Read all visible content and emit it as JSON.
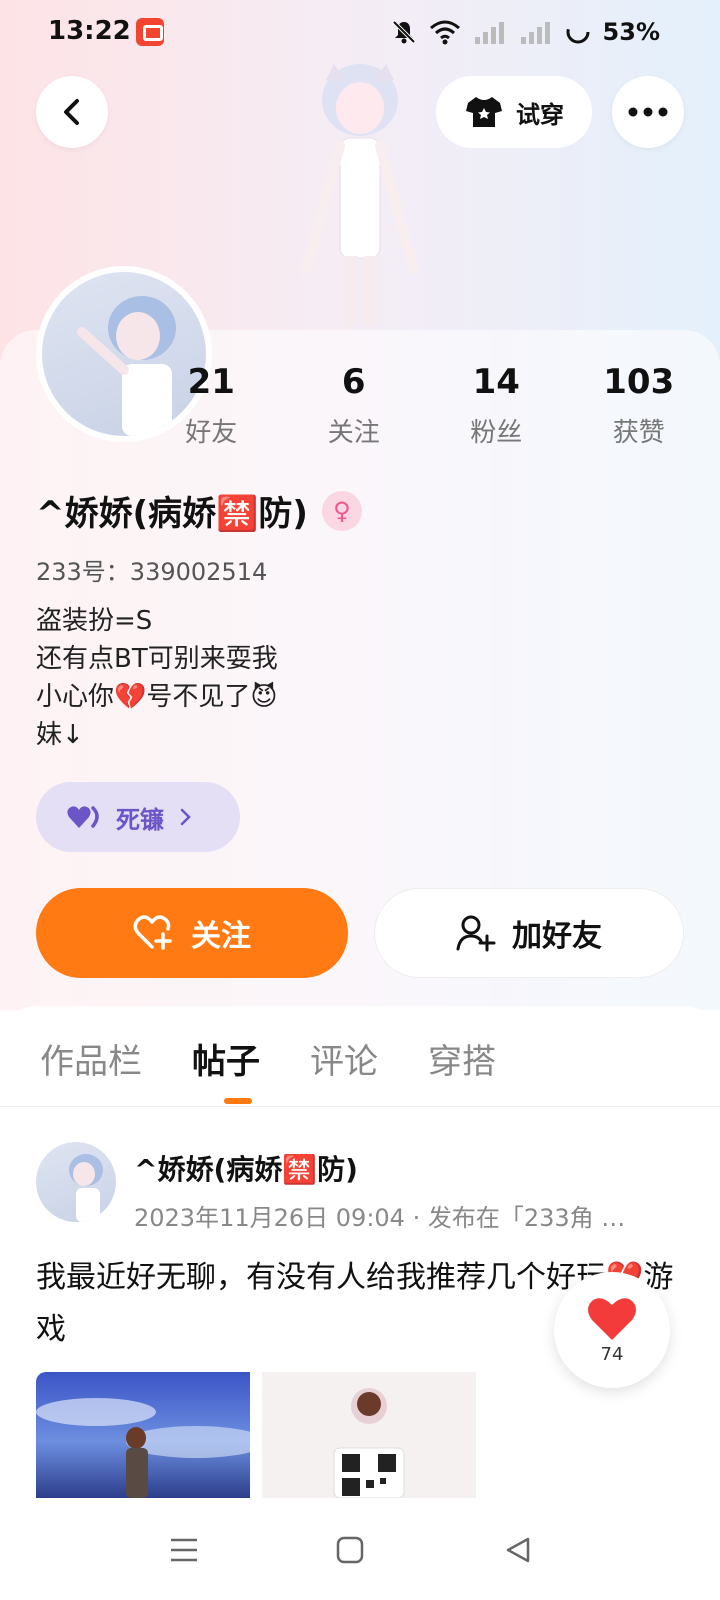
{
  "status_bar": {
    "time": "13:22",
    "battery": "53%",
    "icons": [
      "mute-icon",
      "wifi-icon",
      "signal-icon",
      "signal-icon",
      "battery-icon"
    ]
  },
  "header": {
    "try_on_label": "试穿",
    "icons": {
      "back": "chevron-left-icon",
      "try_on": "tshirt-icon",
      "more": "ellipsis-icon"
    }
  },
  "profile": {
    "stats": [
      {
        "value": "21",
        "label": "好友"
      },
      {
        "value": "6",
        "label": "关注"
      },
      {
        "value": "14",
        "label": "粉丝"
      },
      {
        "value": "103",
        "label": "获赞"
      }
    ],
    "name": "^娇娇(病娇🈲防)",
    "gender_symbol": "♀",
    "user_id": "233号：339002514",
    "bio": [
      "盗装扮=S",
      "还有点BT可别来耍我",
      "小心你💔号不见了😈",
      "妹↓"
    ],
    "title_chip": {
      "label": "死镰",
      "icon": "heart-icon"
    },
    "follow_label": "关注",
    "add_friend_label": "加好友"
  },
  "tabs": [
    {
      "label": "作品栏",
      "active": false
    },
    {
      "label": "帖子",
      "active": true
    },
    {
      "label": "评论",
      "active": false
    },
    {
      "label": "穿搭",
      "active": false
    }
  ],
  "post": {
    "author": "^娇娇(病娇🈲防)",
    "meta": "2023年11月26日  09:04 · 发布在「233角 …",
    "text": "我最近好无聊，有没有人给我推荐几个好玩💔游戏",
    "like_count": "74"
  },
  "colors": {
    "accent": "#ff7a12",
    "title_chip_bg": "#e5dff5",
    "title_chip_text": "#6b55c7",
    "gender_badge": "#f2568f"
  },
  "nav": {
    "icons": [
      "menu-icon",
      "home-square-icon",
      "back-triangle-icon"
    ]
  }
}
